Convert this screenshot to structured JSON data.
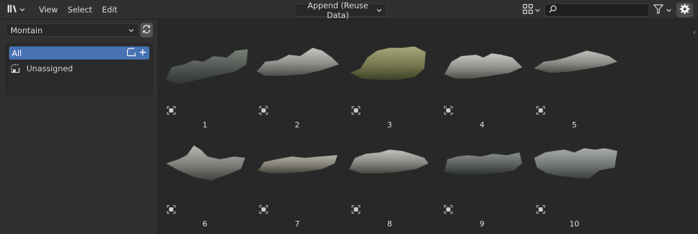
{
  "header": {
    "editor_type_icon": "asset-browser-icon",
    "menus": [
      "View",
      "Select",
      "Edit"
    ],
    "import_method": "Append (Reuse Data)",
    "display_mode_icon": "grid-thumbnails-icon",
    "search": {
      "value": "",
      "placeholder": ""
    },
    "filter_icon": "funnel-icon",
    "settings_icon": "gear-icon"
  },
  "sidebar": {
    "library": "Montain",
    "catalogs": [
      {
        "label": "All",
        "active": true
      },
      {
        "label": "Unassigned",
        "active": false
      }
    ]
  },
  "assets": [
    {
      "name": "1",
      "style": "dark"
    },
    {
      "name": "2",
      "style": "grey"
    },
    {
      "name": "3",
      "style": "green"
    },
    {
      "name": "4",
      "style": "light"
    },
    {
      "name": "5",
      "style": "flat"
    },
    {
      "name": "6",
      "style": "peak"
    },
    {
      "name": "7",
      "style": "slab"
    },
    {
      "name": "8",
      "style": "ridge"
    },
    {
      "name": "9",
      "style": "dark2"
    },
    {
      "name": "10",
      "style": "cliff"
    }
  ],
  "colors": {
    "header_bg": "#303030",
    "accent": "#4772b3",
    "main_bg": "#282828"
  }
}
